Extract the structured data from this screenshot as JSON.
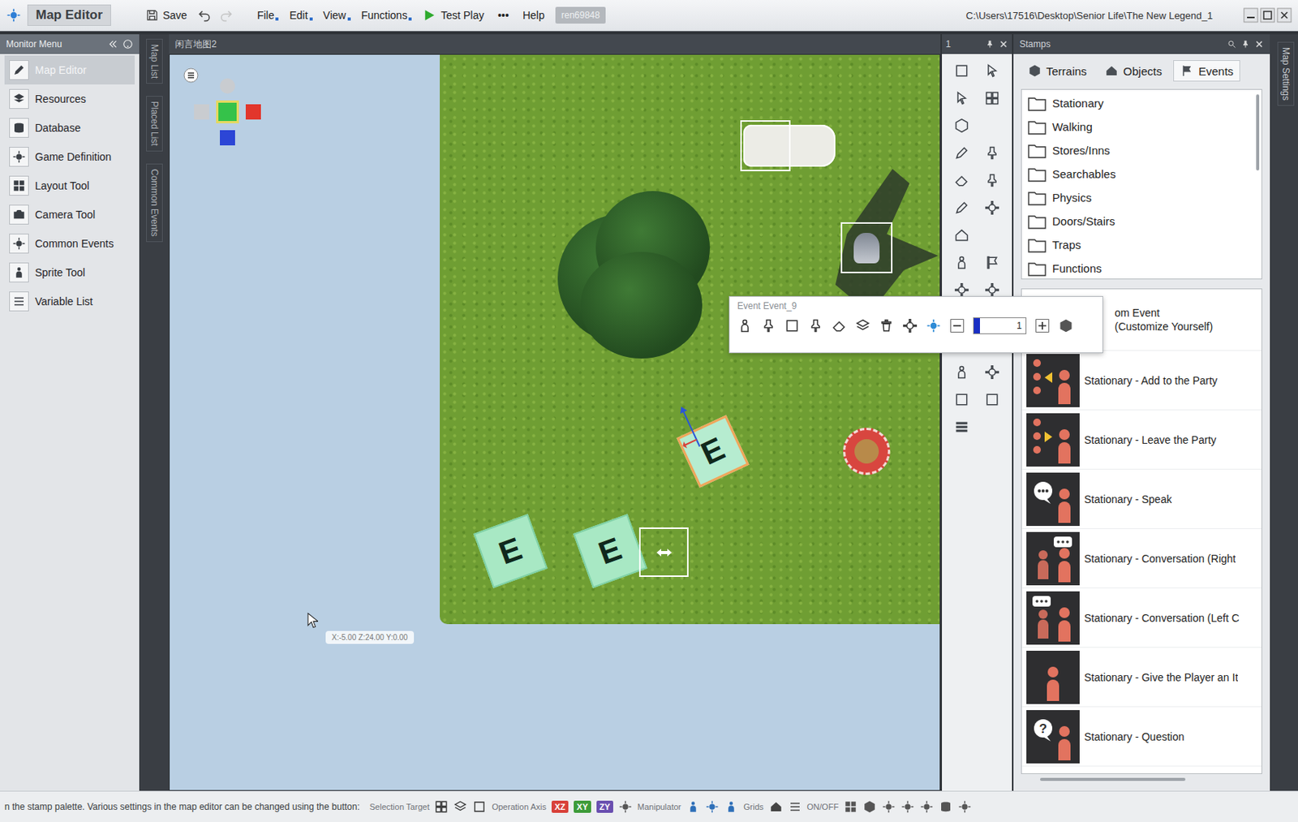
{
  "window": {
    "title": "Map Editor",
    "path": "C:\\Users\\17516\\Desktop\\Senior Life\\The New Legend_1",
    "badge": "ren69848"
  },
  "toolbar": {
    "save": "Save",
    "menus": [
      "File",
      "Edit",
      "View",
      "Functions"
    ],
    "test_play": "Test Play",
    "more": "•••",
    "help": "Help"
  },
  "sidebar": {
    "title": "Monitor Menu",
    "items": [
      {
        "label": "Map Editor",
        "selected": true
      },
      {
        "label": "Resources",
        "selected": false
      },
      {
        "label": "Database",
        "selected": false
      },
      {
        "label": "Game Definition",
        "selected": false
      },
      {
        "label": "Layout Tool",
        "selected": false
      },
      {
        "label": "Camera Tool",
        "selected": false
      },
      {
        "label": "Common Events",
        "selected": false
      },
      {
        "label": "Sprite Tool",
        "selected": false
      },
      {
        "label": "Variable List",
        "selected": false
      }
    ]
  },
  "side_tabs": [
    "Map List",
    "Placed List",
    "Common Events"
  ],
  "map": {
    "title": "闲言地图2",
    "coords": "X:-5.00 Z:24.00 Y:0.00",
    "event_markers": [
      {
        "label": "E",
        "selected": true
      },
      {
        "label": "E",
        "selected": false
      },
      {
        "label": "E",
        "selected": false
      }
    ]
  },
  "event_popup": {
    "title": "Event Event_9",
    "value": "1",
    "level": 0.06
  },
  "tools": {
    "title": "1"
  },
  "stamps": {
    "title": "Stamps",
    "tabs": [
      {
        "label": "Terrains",
        "selected": false
      },
      {
        "label": "Objects",
        "selected": false
      },
      {
        "label": "Events",
        "selected": true
      }
    ],
    "folders": [
      "Stationary",
      "Walking",
      "Stores/Inns",
      "Searchables",
      "Physics",
      "Doors/Stairs",
      "Traps",
      "Functions"
    ],
    "items": [
      {
        "label": "om Event",
        "sub": "(Customize Yourself)",
        "kind": "partial"
      },
      {
        "label": "Stationary - Add to the Party",
        "kind": "stamp"
      },
      {
        "label": "Stationary - Leave the Party",
        "kind": "stamp"
      },
      {
        "label": "Stationary - Speak",
        "kind": "stamp"
      },
      {
        "label": "Stationary - Conversation (Right",
        "kind": "stamp"
      },
      {
        "label": "Stationary - Conversation (Left C",
        "kind": "stamp"
      },
      {
        "label": "Stationary - Give the Player an It",
        "kind": "stamp"
      },
      {
        "label": "Stationary - Question",
        "kind": "stamp",
        "glyph": "?"
      }
    ]
  },
  "map_settings": "Map Settings",
  "status_bar": {
    "hint": "n the stamp palette. Various settings in the map editor can be changed using the button:",
    "selection_target": "Selection Target",
    "operation_axis": "Operation Axis",
    "axes": [
      {
        "label": "XZ",
        "color": "#d8413a"
      },
      {
        "label": "XY",
        "color": "#3e9b3a"
      },
      {
        "label": "ZY",
        "color": "#6a4fb0"
      }
    ],
    "manipulator": "Manipulator",
    "grids": "Grids",
    "toggle": "ON/OFF"
  }
}
